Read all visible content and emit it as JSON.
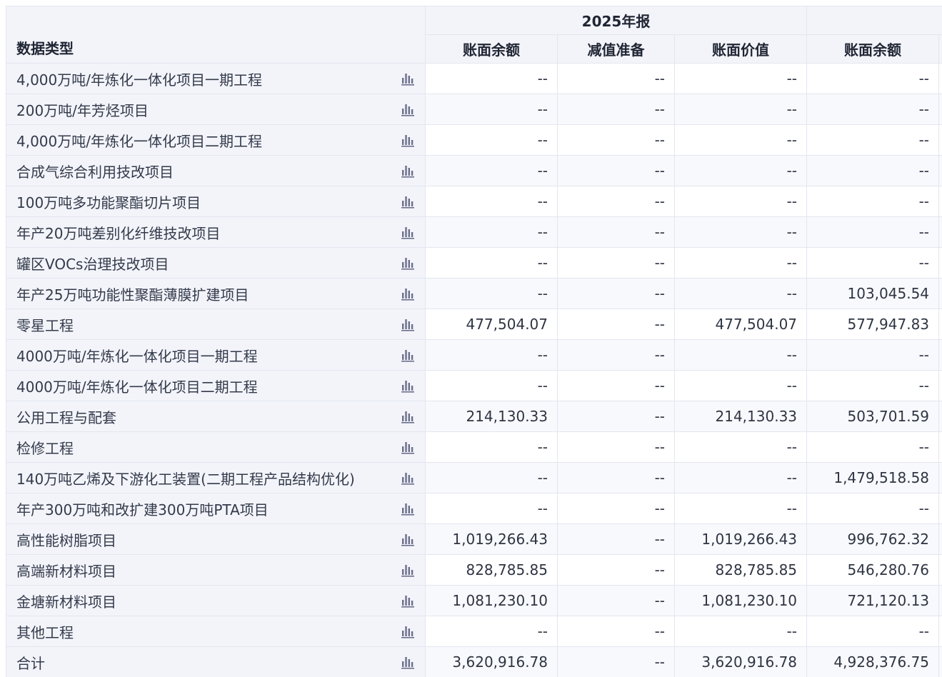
{
  "header": {
    "period": "2025年报",
    "type_col": "数据类型",
    "columns": [
      "账面余额",
      "减值准备",
      "账面价值",
      "账面余额"
    ]
  },
  "icons": {
    "row_chart": "bar-chart-icon",
    "color": "#6b6f8a"
  },
  "rows": [
    {
      "name": "4,000万吨/年炼化一体化项目一期工程",
      "v": [
        "--",
        "--",
        "--",
        "--"
      ]
    },
    {
      "name": "200万吨/年芳烃项目",
      "v": [
        "--",
        "--",
        "--",
        "--"
      ]
    },
    {
      "name": "4,000万吨/年炼化一体化项目二期工程",
      "v": [
        "--",
        "--",
        "--",
        "--"
      ]
    },
    {
      "name": "合成气综合利用技改项目",
      "v": [
        "--",
        "--",
        "--",
        "--"
      ]
    },
    {
      "name": "100万吨多功能聚酯切片项目",
      "v": [
        "--",
        "--",
        "--",
        "--"
      ]
    },
    {
      "name": "年产20万吨差别化纤维技改项目",
      "v": [
        "--",
        "--",
        "--",
        "--"
      ]
    },
    {
      "name": "罐区VOCs治理技改项目",
      "v": [
        "--",
        "--",
        "--",
        "--"
      ]
    },
    {
      "name": "年产25万吨功能性聚酯薄膜扩建项目",
      "v": [
        "--",
        "--",
        "--",
        "103,045.54"
      ]
    },
    {
      "name": "零星工程",
      "v": [
        "477,504.07",
        "--",
        "477,504.07",
        "577,947.83"
      ]
    },
    {
      "name": "4000万吨/年炼化一体化项目一期工程",
      "v": [
        "--",
        "--",
        "--",
        "--"
      ]
    },
    {
      "name": "4000万吨/年炼化一体化项目二期工程",
      "v": [
        "--",
        "--",
        "--",
        "--"
      ]
    },
    {
      "name": "公用工程与配套",
      "v": [
        "214,130.33",
        "--",
        "214,130.33",
        "503,701.59"
      ]
    },
    {
      "name": "检修工程",
      "v": [
        "--",
        "--",
        "--",
        "--"
      ]
    },
    {
      "name": "140万吨乙烯及下游化工装置(二期工程产品结构优化)",
      "v": [
        "--",
        "--",
        "--",
        "1,479,518.58"
      ]
    },
    {
      "name": "年产300万吨和改扩建300万吨PTA项目",
      "v": [
        "--",
        "--",
        "--",
        "--"
      ]
    },
    {
      "name": "高性能树脂项目",
      "v": [
        "1,019,266.43",
        "--",
        "1,019,266.43",
        "996,762.32"
      ]
    },
    {
      "name": "高端新材料项目",
      "v": [
        "828,785.85",
        "--",
        "828,785.85",
        "546,280.76"
      ]
    },
    {
      "name": "金塘新材料项目",
      "v": [
        "1,081,230.10",
        "--",
        "1,081,230.10",
        "721,120.13"
      ]
    },
    {
      "name": "其他工程",
      "v": [
        "--",
        "--",
        "--",
        "--"
      ]
    },
    {
      "name": "合计",
      "v": [
        "3,620,916.78",
        "--",
        "3,620,916.78",
        "4,928,376.75"
      ]
    }
  ]
}
